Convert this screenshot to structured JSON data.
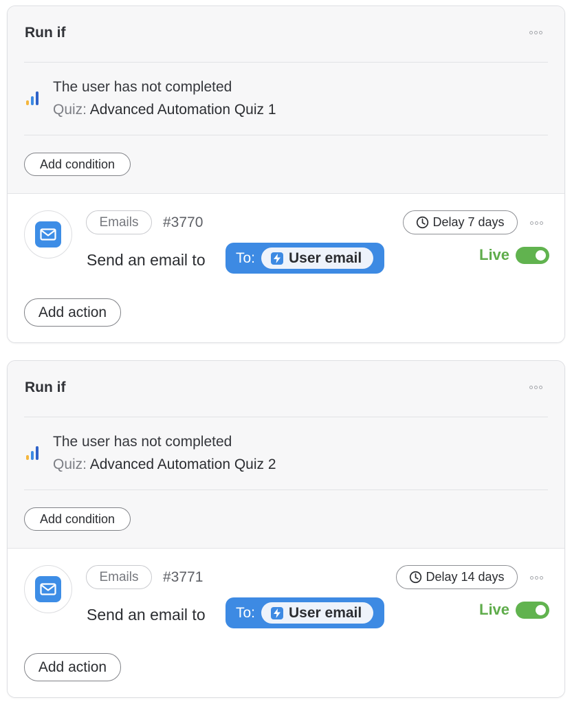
{
  "colors": {
    "accent_blue": "#3d8ae3",
    "live_green": "#5fac4b",
    "toggle_green": "#61b34f",
    "panel_gray": "#f7f7f8"
  },
  "icons": {
    "chart": "bar-chart-icon",
    "more": "more-dots-icon",
    "email": "envelope-icon",
    "delay": "clock-icon",
    "variable": "bolt-icon"
  },
  "blocks": [
    {
      "condition": {
        "title": "Run if",
        "rule_text": "The user has not completed",
        "rule_key": "Quiz:",
        "rule_value": "Advanced Automation Quiz 1",
        "add_condition_label": "Add condition"
      },
      "action": {
        "tag_label": "Emails",
        "number": "#3770",
        "send_text": "Send an email to",
        "to_label": "To:",
        "recipient_label": "User email",
        "delay_label": "Delay 7 days",
        "status_label": "Live",
        "live_enabled": true,
        "add_action_label": "Add action"
      }
    },
    {
      "condition": {
        "title": "Run if",
        "rule_text": "The user has not completed",
        "rule_key": "Quiz:",
        "rule_value": "Advanced Automation Quiz 2",
        "add_condition_label": "Add condition"
      },
      "action": {
        "tag_label": "Emails",
        "number": "#3771",
        "send_text": "Send an email to",
        "to_label": "To:",
        "recipient_label": "User email",
        "delay_label": "Delay 14 days",
        "status_label": "Live",
        "live_enabled": true,
        "add_action_label": "Add action"
      }
    }
  ]
}
